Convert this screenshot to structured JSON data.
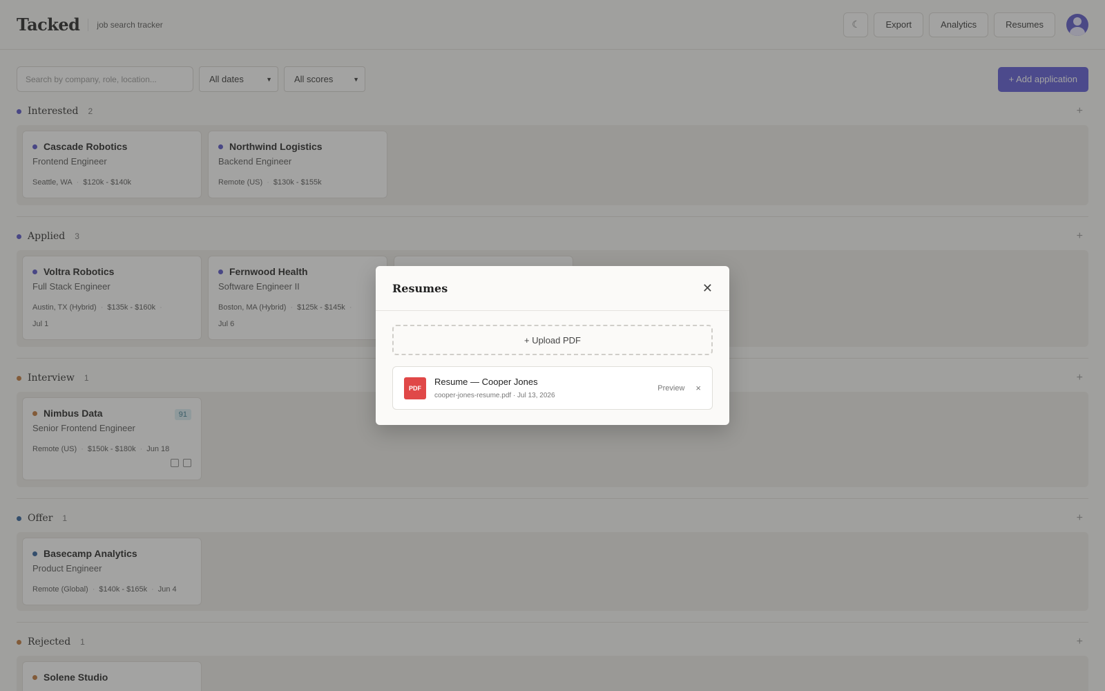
{
  "header": {
    "brand": "Tacked",
    "tagline": "job search tracker",
    "theme_icon": "moon-icon",
    "theme_glyph": "☾",
    "buttons": [
      "Export",
      "Analytics",
      "Resumes"
    ]
  },
  "toolbar": {
    "search_placeholder": "Search by company, role, location...",
    "date_filter": "All dates",
    "score_filter": "All scores",
    "add_label": "+ Add application"
  },
  "lanes": [
    {
      "title": "Interested",
      "count": "2",
      "color": "#5552c8",
      "cards": [
        {
          "company": "Cascade Robotics",
          "role": "Frontend Engineer",
          "meta1": "Seattle, WA",
          "meta2": "$120k - $140k"
        },
        {
          "company": "Northwind Logistics",
          "role": "Backend Engineer",
          "meta1": "Remote (US)",
          "meta2": "$130k - $155k"
        }
      ]
    },
    {
      "title": "Applied",
      "count": "3",
      "color": "#5552c8",
      "cards": [
        {
          "company": "Voltra Robotics",
          "role": "Full Stack Engineer",
          "meta1": "Austin, TX (Hybrid)",
          "meta2": "$135k - $160k",
          "date": "Jul 1"
        },
        {
          "company": "Fernwood Health",
          "role": "Software Engineer II",
          "meta1": "Boston, MA (Hybrid)",
          "meta2": "$125k - $145k",
          "date": "Jul 6"
        }
      ]
    },
    {
      "title": "Interview",
      "count": "1",
      "color": "#c0783a",
      "cards": [
        {
          "company": "Nimbus Data",
          "role": "Senior Frontend Engineer",
          "meta1": "Remote (US)",
          "meta2": "$150k - $180k",
          "meta3": "Jun 18",
          "score": "91"
        }
      ]
    },
    {
      "title": "Offer",
      "count": "1",
      "color": "#2f5f9a",
      "cards": [
        {
          "company": "Basecamp Analytics",
          "role": "Product Engineer",
          "meta1": "Remote (Global)",
          "meta2": "$140k - $165k",
          "meta3": "Jun 4"
        }
      ]
    },
    {
      "title": "Rejected",
      "count": "1",
      "color": "#c0783a",
      "cards": [
        {
          "company": "Solene Studio"
        }
      ]
    }
  ],
  "modal": {
    "title": "Resumes",
    "upload_label": "+ Upload PDF",
    "resume": {
      "badge": "PDF",
      "name": "Resume — Cooper Jones",
      "file": "cooper-jones-resume.pdf · Jul 13, 2026",
      "preview_label": "Preview",
      "remove_glyph": "×"
    },
    "close_glyph": "✕"
  }
}
